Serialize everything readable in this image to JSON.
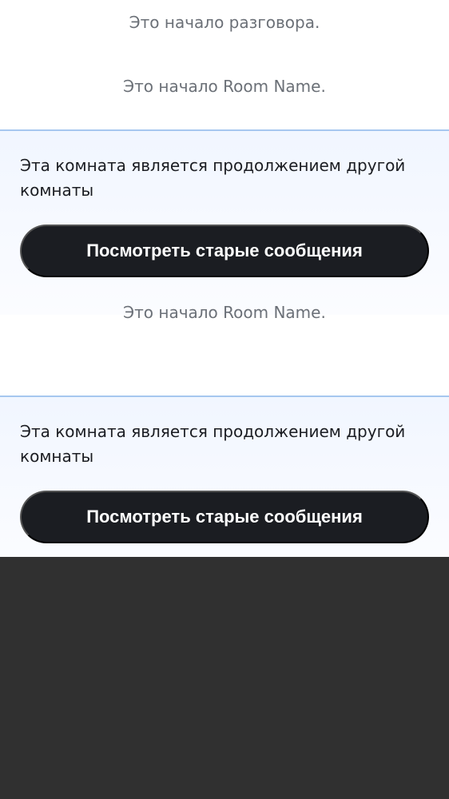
{
  "timeline": {
    "notice_start_conversation": "Это начало разговора.",
    "notice_room_start_1": "Это начало Room Name.",
    "notice_room_start_2": "Это начало Room Name."
  },
  "upgrade_panels": [
    {
      "text": "Эта комната является продолжением другой комнаты",
      "button_label": "Посмотреть старые сообщения"
    },
    {
      "text": "Эта комната является продолжением другой комнаты",
      "button_label": "Посмотреть старые сообщения"
    }
  ],
  "colors": {
    "panel_border": "#a6c7ef",
    "button_background": "#1b1d22",
    "notice_text": "#6b7077",
    "bottom_background": "#303030"
  }
}
